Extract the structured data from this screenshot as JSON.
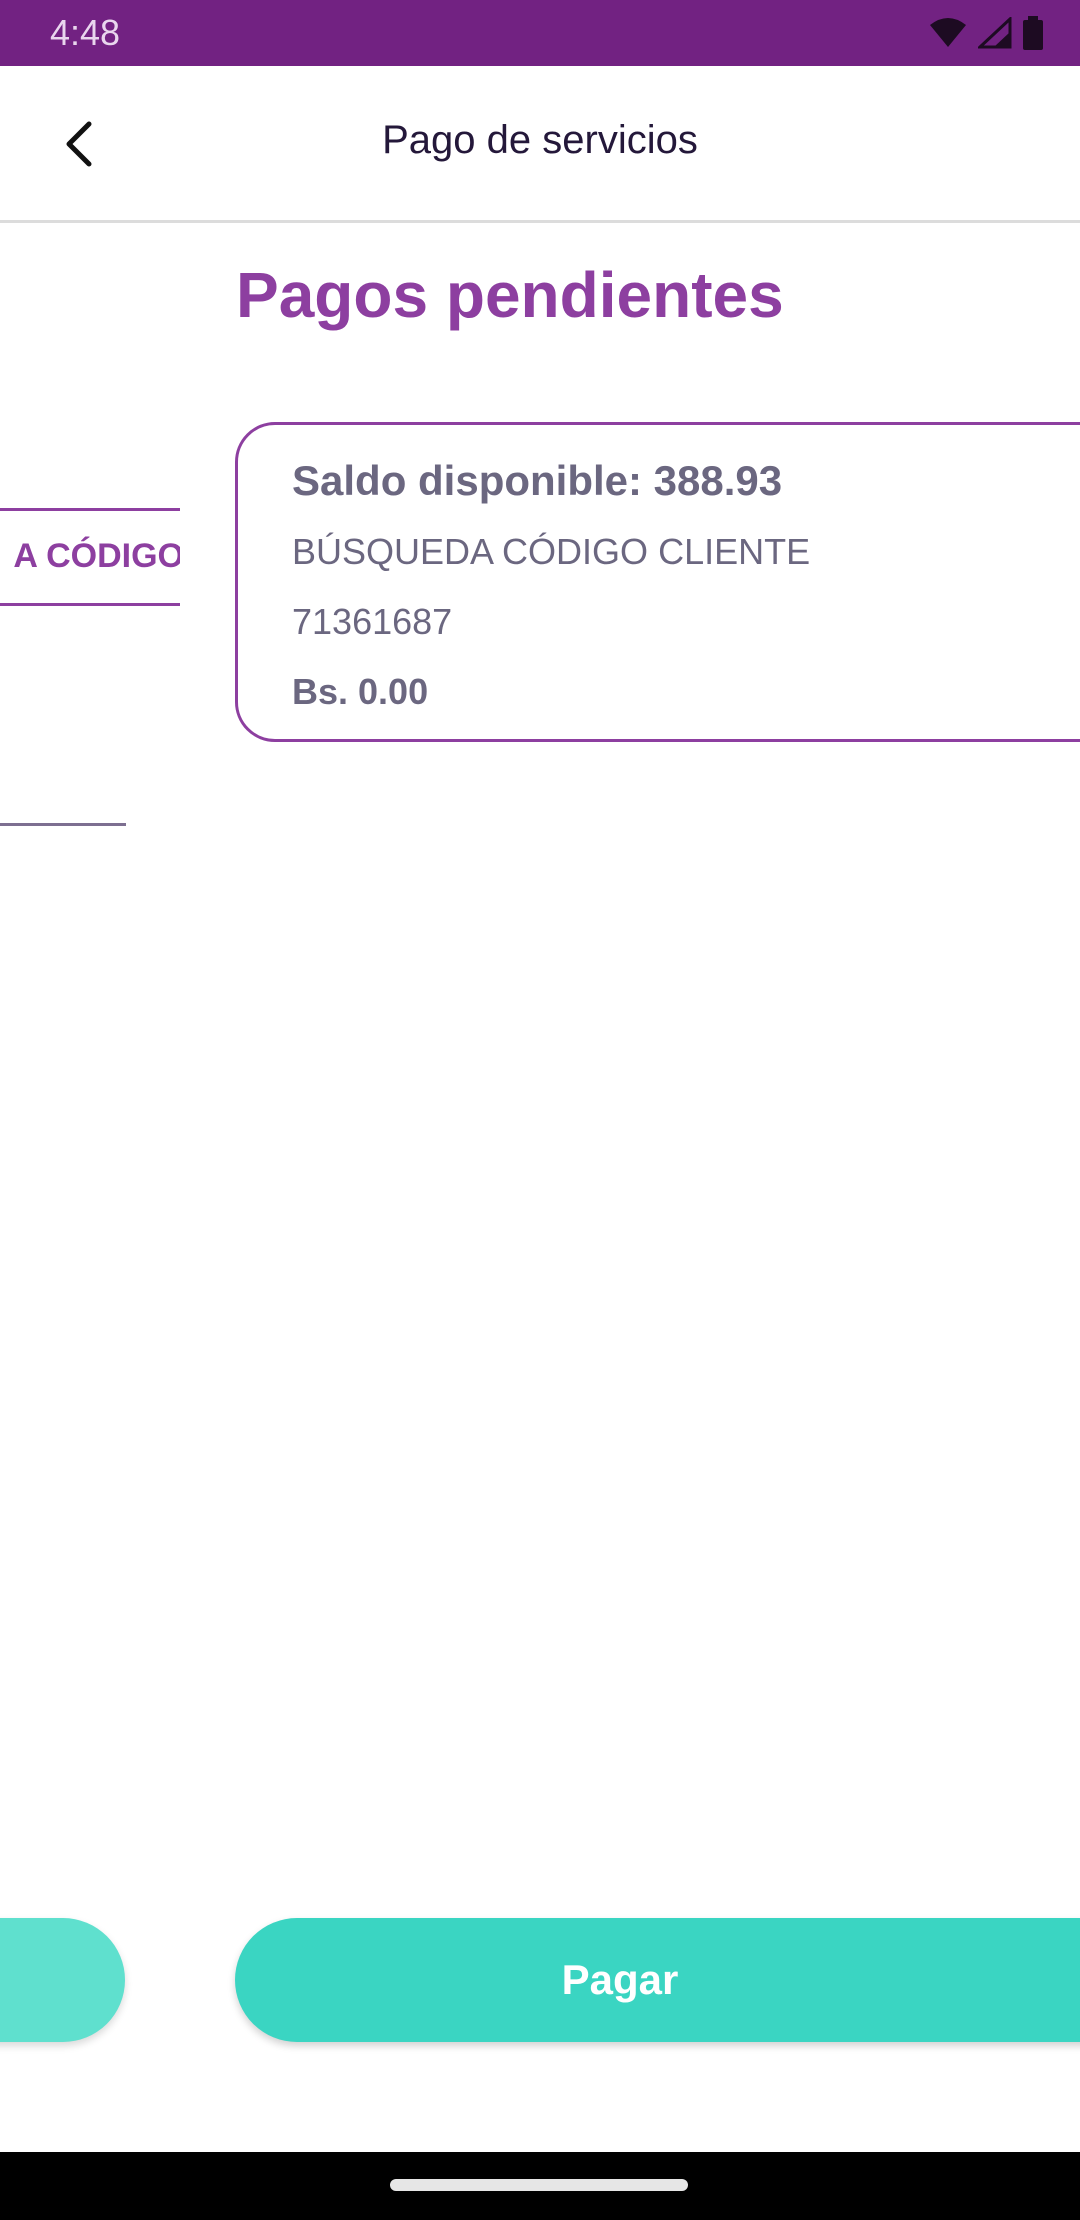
{
  "status_bar": {
    "time": "4:48",
    "icons": [
      "wifi-icon",
      "signal-icon",
      "battery-icon"
    ],
    "background": "#722282"
  },
  "app_bar": {
    "title": "Pago de servicios",
    "back_icon": "chevron-left-icon"
  },
  "main": {
    "section_title": "Pagos pendientes",
    "left_card_label": "A CÓDIGO D",
    "card": {
      "balance": "Saldo disponible: 388.93",
      "service": "BÚSQUEDA CÓDIGO CLIENTE",
      "code": "71361687",
      "amount": "Bs. 0.00"
    }
  },
  "buttons": {
    "pay_label": "Pagar"
  },
  "colors": {
    "accent": "#8d3fa0",
    "primary_button": "#3ad5c2",
    "secondary_button": "#5fe0ce",
    "text_muted": "#6b6780"
  }
}
